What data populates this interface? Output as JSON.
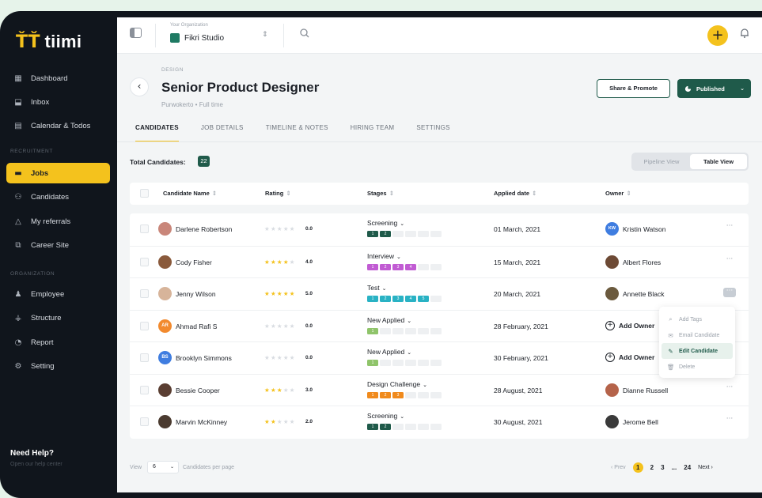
{
  "brand": {
    "name": "tiimi"
  },
  "sidebar": {
    "items": [
      {
        "label": "Dashboard",
        "icon": "dashboard-icon",
        "glyph": "▦"
      },
      {
        "label": "Inbox",
        "icon": "inbox-icon",
        "glyph": "⬓"
      },
      {
        "label": "Calendar & Todos",
        "icon": "calendar-icon",
        "glyph": "▤"
      }
    ],
    "recruitment_label": "RECRUITMENT",
    "recruitment": [
      {
        "label": "Jobs",
        "icon": "briefcase-icon",
        "glyph": "▬",
        "active": true
      },
      {
        "label": "Candidates",
        "icon": "people-icon",
        "glyph": "⚇"
      },
      {
        "label": "My referrals",
        "icon": "referral-icon",
        "glyph": "△"
      },
      {
        "label": "Career Site",
        "icon": "career-site-icon",
        "glyph": "⧉"
      }
    ],
    "organization_label": "ORGANIZATION",
    "organization": [
      {
        "label": "Employee",
        "icon": "employee-icon",
        "glyph": "♟"
      },
      {
        "label": "Structure",
        "icon": "structure-icon",
        "glyph": "⚶"
      },
      {
        "label": "Report",
        "icon": "report-icon",
        "glyph": "◔"
      },
      {
        "label": "Setting",
        "icon": "gear-icon",
        "glyph": "⚙"
      }
    ],
    "help_title": "Need Help?",
    "help_sub": "Open our help center"
  },
  "topbar": {
    "org_label": "Your Organization",
    "org_name": "Fikri Studio",
    "org_chevron": "⇕",
    "add_glyph": "+"
  },
  "job": {
    "eyebrow": "DESIGN",
    "title": "Senior Product Designer",
    "more": "···",
    "subtitle": "Purwokerto  •  Full time",
    "share_label": "Share & Promote",
    "publish_label": "Published",
    "publish_chevron": "⌄"
  },
  "tabs": [
    "CANDIDATES",
    "JOB DETAILS",
    "TIMELINE & NOTES",
    "HIRING TEAM",
    "SETTINGS"
  ],
  "summary": {
    "total_label": "Total Candidates:",
    "total_count": "22",
    "view_options": [
      "Pipeline View",
      "Table View"
    ],
    "active_view": "Table View"
  },
  "table": {
    "columns": [
      "Candidate Name",
      "Rating",
      "Stages",
      "Applied date",
      "Owner"
    ],
    "sort_glyph": "⇕",
    "add_owner_label": "Add Owner",
    "rows": [
      {
        "name": "Darlene Robertson",
        "avatar_color": "#c9867a",
        "avatar_text": "",
        "stars": 0,
        "rating": "0.0",
        "stage": "Screening",
        "stage_total": 6,
        "stage_filled": 2,
        "stage_color": "#1f5a4a",
        "applied": "01 March, 2021",
        "owner": "Kristin Watson",
        "owner_initials": "KW",
        "owner_color": "#3f7de0"
      },
      {
        "name": "Cody Fisher",
        "avatar_color": "#8a5a3c",
        "avatar_text": "",
        "stars": 4,
        "rating": "4.0",
        "stage": "Interview",
        "stage_total": 6,
        "stage_filled": 4,
        "stage_color": "#c15bd3",
        "applied": "15 March, 2021",
        "owner": "Albert Flores",
        "owner_initials": "",
        "owner_color": "#6d4a35"
      },
      {
        "name": "Jenny Wilson",
        "avatar_color": "#d7b49a",
        "avatar_text": "",
        "stars": 5,
        "rating": "5.0",
        "stage": "Test",
        "stage_total": 6,
        "stage_filled": 5,
        "stage_color": "#29b2c4",
        "applied": "20 March, 2021",
        "owner": "Annette Black",
        "owner_initials": "",
        "owner_color": "#6b5a3e"
      },
      {
        "name": "Ahmad Rafi S",
        "avatar_color": "#f28a2e",
        "avatar_text": "AR",
        "stars": 0,
        "rating": "0.0",
        "stage": "New Applied",
        "stage_total": 6,
        "stage_filled": 1,
        "stage_color": "#8fc46a",
        "applied": "28 February, 2021",
        "owner": "",
        "owner_initials": "",
        "owner_color": ""
      },
      {
        "name": "Brooklyn Simmons",
        "avatar_color": "#3f7de0",
        "avatar_text": "BS",
        "stars": 0,
        "rating": "0.0",
        "stage": "New Applied",
        "stage_total": 6,
        "stage_filled": 1,
        "stage_color": "#8fc46a",
        "applied": "30 February, 2021",
        "owner": "",
        "owner_initials": "",
        "owner_color": ""
      },
      {
        "name": "Bessie Cooper",
        "avatar_color": "#5a3e32",
        "avatar_text": "",
        "stars": 3,
        "rating": "3.0",
        "stage": "Design Challenge",
        "stage_total": 6,
        "stage_filled": 3,
        "stage_color": "#f08a1c",
        "applied": "28 August, 2021",
        "owner": "Dianne Russell",
        "owner_initials": "",
        "owner_color": "#b5634a"
      },
      {
        "name": "Marvin McKinney",
        "avatar_color": "#4b3b30",
        "avatar_text": "",
        "stars": 2,
        "rating": "2.0",
        "stage": "Screening",
        "stage_total": 6,
        "stage_filled": 2,
        "stage_color": "#1f5a4a",
        "applied": "30 August, 2021",
        "owner": "Jerome Bell",
        "owner_initials": "",
        "owner_color": "#3a3a3a"
      }
    ]
  },
  "row_menu": {
    "items": [
      {
        "label": "Add Tags",
        "icon": "tag-icon",
        "glyph": "⌕"
      },
      {
        "label": "Email Candidate",
        "icon": "mail-icon",
        "glyph": "✉"
      },
      {
        "label": "Edit Candidate",
        "icon": "edit-icon",
        "glyph": "✎",
        "active": true
      },
      {
        "label": "Delete",
        "icon": "trash-icon",
        "glyph": "🗑"
      }
    ]
  },
  "footer": {
    "view_label": "View",
    "per_page_value": "6",
    "per_page_label": "Candidates per page",
    "prev_label": "‹ Prev",
    "next_label": "Next ›",
    "pages": [
      "1",
      "2",
      "3",
      "...",
      "24"
    ],
    "current_page": "1"
  },
  "colors": {
    "accent": "#f4c21d",
    "brand_green": "#1f5a4a",
    "sidebar_bg": "#10151c"
  }
}
